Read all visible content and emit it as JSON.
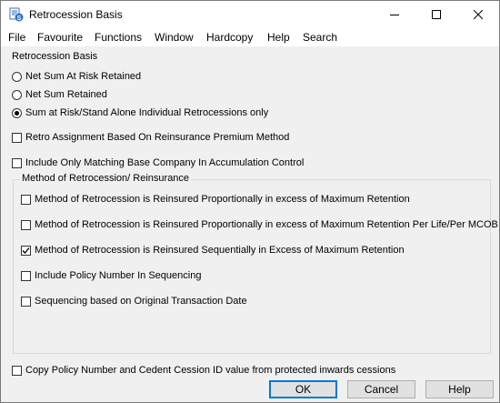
{
  "window": {
    "title": "Retrocession Basis",
    "icon": "app-icon",
    "controls": {
      "minimize": "minimize-icon",
      "maximize": "maximize-icon",
      "close": "close-icon"
    }
  },
  "menu": {
    "items": [
      "File",
      "Favourite",
      "Functions",
      "Window",
      "Hardcopy",
      "Help",
      "Search"
    ]
  },
  "basis": {
    "label": "Retrocession Basis",
    "radios": [
      {
        "label": "Net Sum At Risk Retained",
        "selected": false
      },
      {
        "label": "Net Sum Retained",
        "selected": false
      },
      {
        "label": "Sum at Risk/Stand Alone Individual Retrocessions only",
        "selected": true
      }
    ]
  },
  "options": {
    "retro_assignment": {
      "label": "Retro Assignment Based On Reinsurance Premium  Method",
      "checked": false
    },
    "include_matching": {
      "label": "Include Only Matching Base Company In Accumulation Control",
      "checked": false
    }
  },
  "method": {
    "label": "Method of Retrocession/ Reinsurance",
    "items": [
      {
        "label": "Method of Retrocession is Reinsured Proportionally in excess of Maximum Retention",
        "checked": false
      },
      {
        "label": "Method of Retrocession is Reinsured Proportionally in excess of Maximum Retention Per Life/Per MCOB",
        "checked": false
      },
      {
        "label": "Method of Retrocession is Reinsured Sequentially in Excess of Maximum Retention",
        "checked": true
      },
      {
        "label": "Include Policy Number In Sequencing",
        "checked": false
      },
      {
        "label": "Sequencing based on Original Transaction Date",
        "checked": false
      }
    ]
  },
  "copy_option": {
    "label": "Copy Policy Number and Cedent Cession ID value from protected inwards cessions",
    "checked": false
  },
  "buttons": {
    "ok": "OK",
    "cancel": "Cancel",
    "help": "Help"
  },
  "colors": {
    "accent": "#0078d7",
    "window_bg": "#f0f0f0",
    "button_bg": "#e1e1e1"
  }
}
